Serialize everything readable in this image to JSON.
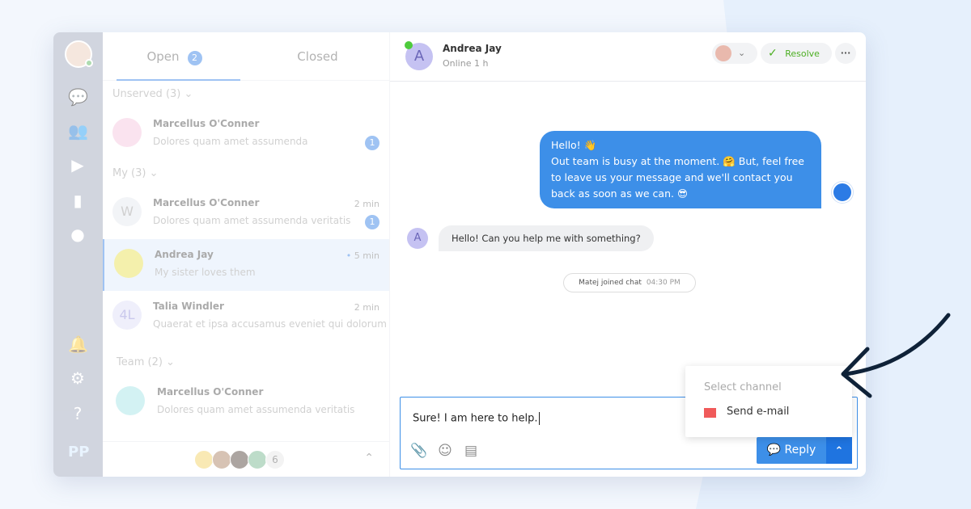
{
  "sidebar": {
    "icons": [
      "chat-icon",
      "contacts-icon",
      "play-icon",
      "stats-icon",
      "bot-icon",
      "bell-icon",
      "gear-icon",
      "help-icon",
      "logo"
    ]
  },
  "list": {
    "tabs": [
      {
        "label": "Open",
        "count": "2"
      },
      {
        "label": "Closed"
      }
    ],
    "sections": [
      {
        "label": "Unserved (3)",
        "items": [
          {
            "name": "Marcellus O'Conner",
            "preview": "Dolores quam amet assumenda",
            "count": "1"
          }
        ]
      },
      {
        "label": "My (3)",
        "items": [
          {
            "name": "Marcellus O'Conner",
            "preview": "Dolores quam amet assumenda veritatis",
            "time": "2 min",
            "count": "1",
            "initial": "W"
          },
          {
            "name": "Andrea Jay",
            "preview": "My sister loves them",
            "time": "5 min"
          },
          {
            "name": "Talia Windler",
            "preview": "Quaerat et ipsa accusamus eveniet qui dolorum",
            "time": "2 min",
            "initial": "4L"
          }
        ]
      },
      {
        "label": "Team (2)",
        "items": [
          {
            "name": "Marcellus O'Conner",
            "preview": "Dolores quam amet assumenda veritatis"
          }
        ]
      }
    ],
    "team_count": "6"
  },
  "chat": {
    "contact": {
      "initial": "A",
      "name": "Andrea Jay",
      "status": "Online 1 h"
    },
    "resolve_label": "Resolve",
    "messages": {
      "out": [
        "Hello! 👋",
        "Out team is busy at the moment. 🤗 But, feel free to leave us your message and we'll contact you back as soon as we can. 😎"
      ],
      "in": "Hello! Can you help me with something?",
      "system_name": "Matej",
      "system_text": "joined chat",
      "system_time": "04:30 PM"
    },
    "composer": {
      "text": "Sure! I am here to help.",
      "reply_label": "Reply"
    },
    "channel_menu": {
      "title": "Select channel",
      "option": "Send e-mail"
    }
  },
  "colors": {
    "accent": "#3d8fe8",
    "resolve": "#4caf22",
    "email": "#f05a5a",
    "dark_arrow": "#0f2238"
  }
}
